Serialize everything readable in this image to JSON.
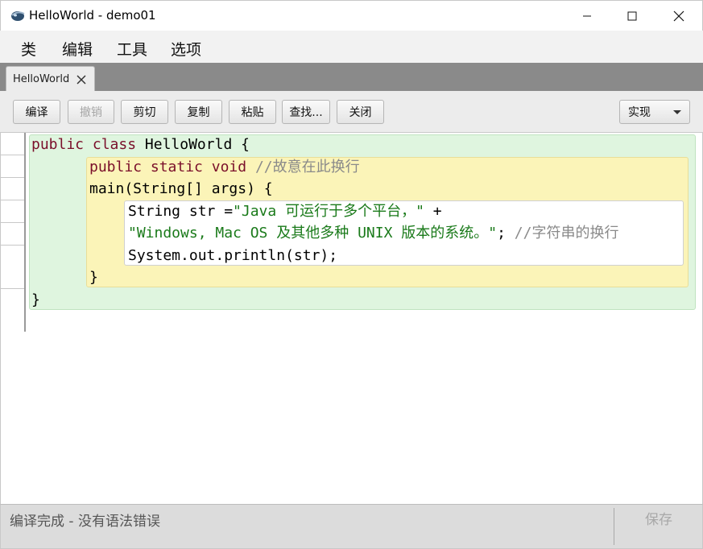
{
  "window": {
    "title": "HelloWorld - demo01",
    "icon": "eclipse-sphere-icon",
    "controls": [
      "minimize-icon",
      "maximize-icon",
      "close-icon"
    ]
  },
  "menubar": {
    "items": [
      "类",
      "编辑",
      "工具",
      "选项"
    ]
  },
  "tabs": [
    {
      "label": "HelloWorld",
      "closable": true
    }
  ],
  "toolbar": {
    "buttons": [
      {
        "label": "编译",
        "enabled": true
      },
      {
        "label": "撤销",
        "enabled": false
      },
      {
        "label": "剪切",
        "enabled": true
      },
      {
        "label": "复制",
        "enabled": true
      },
      {
        "label": "粘贴",
        "enabled": true
      },
      {
        "label": "查找...",
        "enabled": true
      },
      {
        "label": "关闭",
        "enabled": true
      }
    ],
    "view_select": {
      "value": "实现"
    }
  },
  "code": {
    "line1": {
      "kw1": "public",
      "kw2": "class",
      "rest": "HelloWorld {"
    },
    "line2": {
      "kw1": "public",
      "kw2": "static",
      "kw3": "void",
      "comment": "//故意在此换行"
    },
    "line3": {
      "text": "main(String[] args) {"
    },
    "line4": {
      "text": "String str =",
      "str": "\"Java 可运行于多个平台，\"",
      "rest": " +"
    },
    "line5": {
      "str": "\"Windows, Mac OS 及其他多种 UNIX 版本的系统。\"",
      "rest": "; ",
      "comment": "//字符串的换行"
    },
    "line6": {
      "text": "System.out.println(str);"
    },
    "line7": {
      "text": "}"
    },
    "line8": {
      "text": "}"
    }
  },
  "colors": {
    "keyword": "#7a0f2a",
    "string": "#1a7a1a",
    "comment": "#8a8a8a",
    "class_scope": "#dff5df",
    "method_scope": "#fbf4b8"
  },
  "statusbar": {
    "message": "编译完成 - 没有语法错误",
    "save_label": "保存",
    "save_enabled": false
  }
}
